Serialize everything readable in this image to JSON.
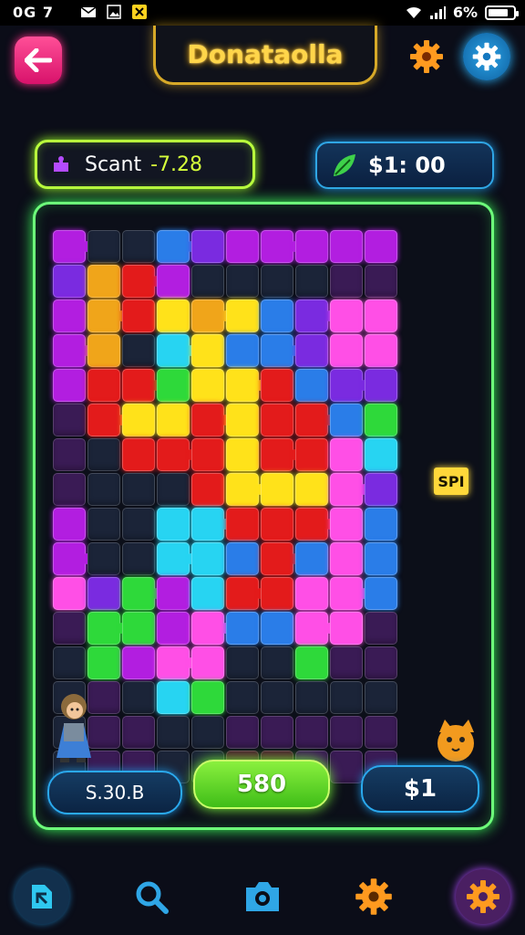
{
  "status_bar": {
    "time": "0G 7",
    "battery": "6%"
  },
  "header": {
    "title": "Donataolla"
  },
  "stats": {
    "score_label": "Scant",
    "score_value": "-7.28",
    "coins_value": "$1: 00"
  },
  "board": {
    "tag_label": "SPI"
  },
  "bottom": {
    "left_button": "S.30.B",
    "center_button": "580",
    "right_button": "$1"
  },
  "nav": {
    "icons": [
      "bookmark-icon",
      "search-icon",
      "camera-icon",
      "gear-icon",
      "settings-icon"
    ]
  },
  "colors": {
    "accent_green": "#6dff7a",
    "accent_gold": "#ffd54a",
    "accent_blue": "#2aa9ee",
    "back_pink": "#ff2f8a"
  }
}
